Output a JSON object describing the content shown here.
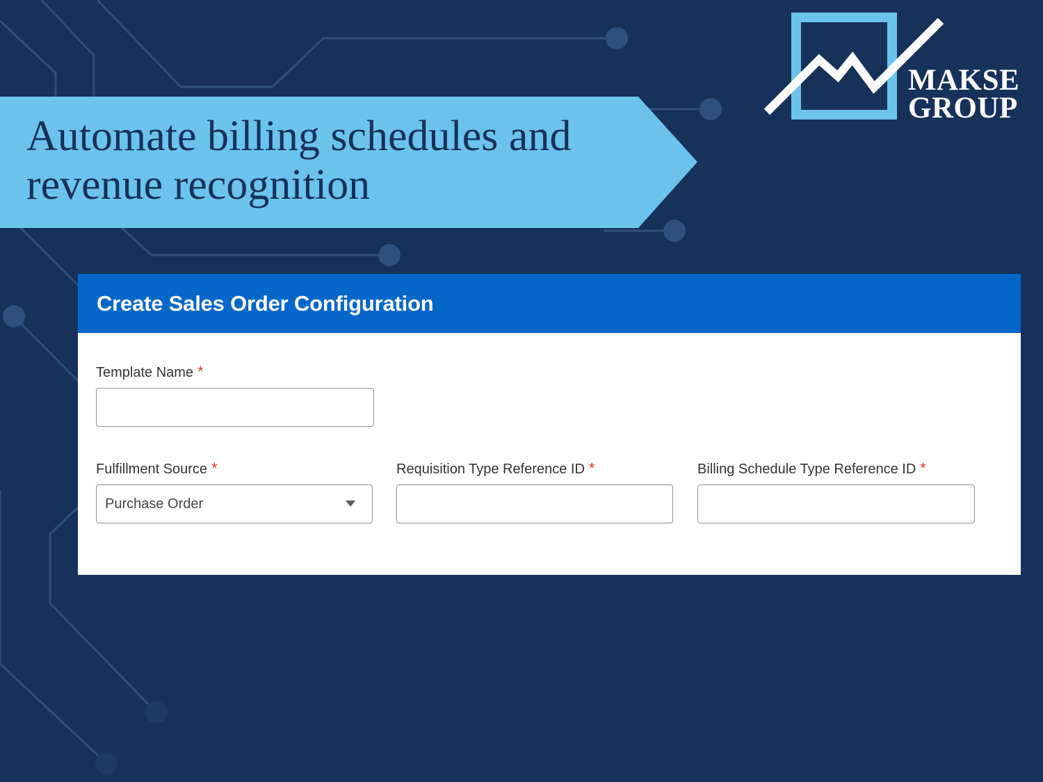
{
  "banner": {
    "title": "Automate billing schedules and revenue recognition"
  },
  "logo": {
    "line1": "MAKSE",
    "line2": "GROUP"
  },
  "form": {
    "title": "Create Sales Order Configuration",
    "template_name": {
      "label": "Template Name",
      "required_mark": "*",
      "value": ""
    },
    "fulfillment_source": {
      "label": "Fulfillment Source",
      "required_mark": "*",
      "value": "Purchase Order"
    },
    "requisition_type": {
      "label": "Requisition Type Reference ID",
      "required_mark": "*",
      "value": ""
    },
    "billing_schedule_type": {
      "label": "Billing Schedule Type Reference ID",
      "required_mark": "*",
      "value": ""
    }
  },
  "colors": {
    "background": "#16315a",
    "banner": "#6bc3ec",
    "header": "#0567c9",
    "required": "#e23b2e"
  }
}
